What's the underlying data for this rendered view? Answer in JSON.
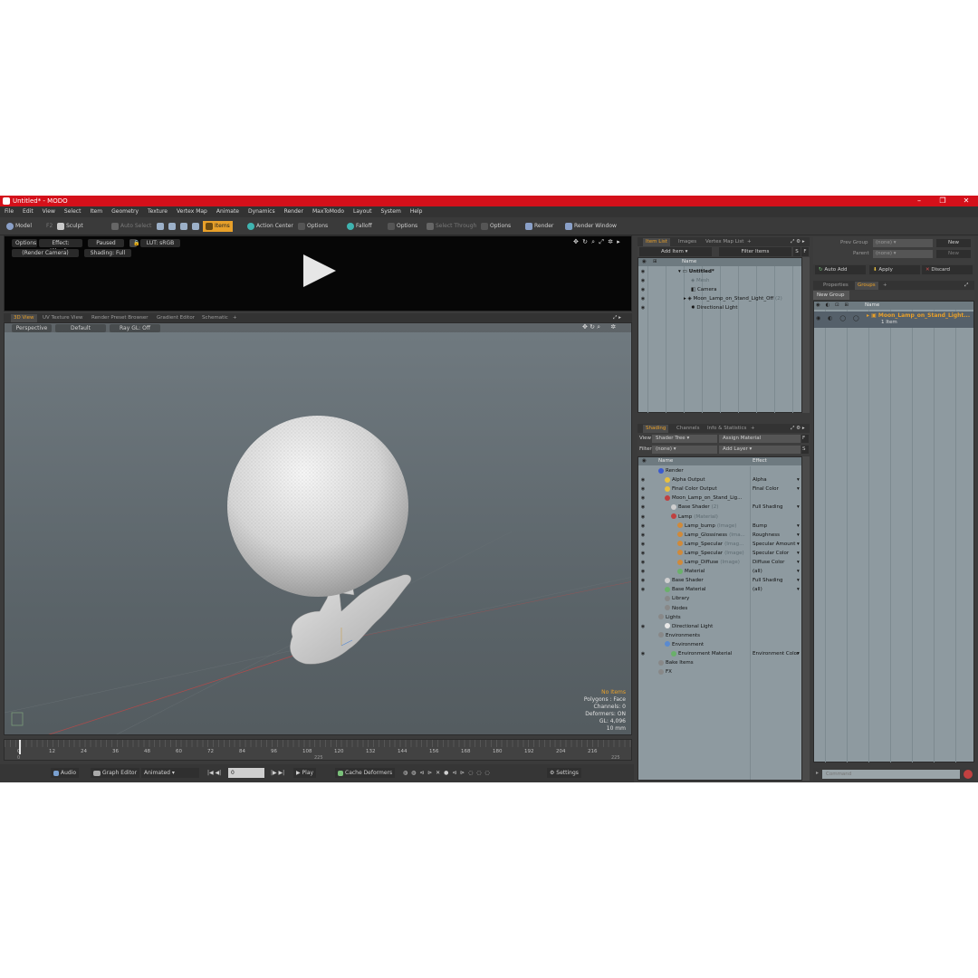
{
  "window": {
    "title": "Untitled* - MODO",
    "controls": [
      "–",
      "❐",
      "✕"
    ]
  },
  "menu": [
    "File",
    "Edit",
    "View",
    "Select",
    "Item",
    "Geometry",
    "Texture",
    "Vertex Map",
    "Animate",
    "Dynamics",
    "Render",
    "MaxToModo",
    "Layout",
    "System",
    "Help"
  ],
  "toolbar": {
    "model": "Model",
    "f2": "F2",
    "sculpt": "Sculpt",
    "auto_select": "Auto Select",
    "items": "Items",
    "action_center": "Action Center",
    "options1": "Options",
    "falloff": "Falloff",
    "options2": "Options",
    "select_through": "Select Through",
    "options3": "Options",
    "render": "Render",
    "render_window": "Render Window"
  },
  "render_preview": {
    "options": "Options",
    "effect": "Effect: (Shadi...",
    "paused": "Paused",
    "lut": "LUT: sRGB",
    "camera": "(Render Camera)",
    "shading": "Shading: Full"
  },
  "viewport_tabs": [
    "3D View",
    "UV Texture View",
    "Render Preset Browser",
    "Gradient Editor",
    "Schematic",
    "+"
  ],
  "viewport": {
    "perspective": "Perspective",
    "default": "Default",
    "raygl": "Ray GL: Off",
    "info": {
      "no_items": "No Items",
      "polygons": "Polygons : Face",
      "channels": "Channels: 0",
      "deformers": "Deformers: ON",
      "gl": "GL: 4,096",
      "scale": "10 mm"
    }
  },
  "timeline": {
    "ticks": [
      "0",
      "12",
      "24",
      "36",
      "48",
      "60",
      "72",
      "84",
      "96",
      "108",
      "120",
      "132",
      "144",
      "156",
      "168",
      "180",
      "192",
      "204",
      "216"
    ],
    "start": "0",
    "mid": "225",
    "end": "225"
  },
  "bottombar": {
    "audio": "Audio",
    "graph_editor": "Graph Editor",
    "animated": "Animated",
    "frame": "0",
    "play": "Play",
    "cache_deformers": "Cache Deformers",
    "settings": "Settings"
  },
  "item_list": {
    "tabs": [
      "Item List",
      "Images",
      "Vertex Map List",
      "+"
    ],
    "add_item": "Add Item",
    "filter_items": "Filter Items",
    "s": "S",
    "f": "F",
    "col_name": "Name",
    "items": [
      {
        "label": "Untitled*",
        "indent": 0
      },
      {
        "label": "Mesh",
        "indent": 1
      },
      {
        "label": "Camera",
        "indent": 1
      },
      {
        "label": "Moon_Lamp_on_Stand_Light_Off",
        "suffix": "(2)",
        "indent": 1
      },
      {
        "label": "Directional Light",
        "indent": 1
      }
    ]
  },
  "shading": {
    "tabs": [
      "Shading",
      "Channels",
      "Info & Statistics",
      "+"
    ],
    "view_label": "View",
    "view_value": "Shader Tree",
    "assign_material": "Assign Material",
    "filter_label": "Filter",
    "filter_value": "(none)",
    "add_layer": "Add Layer",
    "f": "F",
    "s": "S",
    "col_name": "Name",
    "col_effect": "Effect",
    "rows": [
      {
        "label": "Render",
        "effect": "",
        "indent": 0
      },
      {
        "label": "Alpha Output",
        "effect": "Alpha",
        "indent": 1
      },
      {
        "label": "Final Color Output",
        "effect": "Final Color",
        "indent": 1
      },
      {
        "label": "Moon_Lamp_on_Stand_Lig...",
        "effect": "",
        "indent": 1
      },
      {
        "label": "Base Shader",
        "suffix": "(2)",
        "effect": "Full Shading",
        "indent": 2
      },
      {
        "label": "Lamp",
        "suffix": "(Material)",
        "effect": "",
        "indent": 2
      },
      {
        "label": "Lamp_bump",
        "suffix": "(Image)",
        "effect": "Bump",
        "indent": 3
      },
      {
        "label": "Lamp_Glossiness",
        "suffix": "(Ima...",
        "effect": "Roughness",
        "indent": 3
      },
      {
        "label": "Lamp_Specular",
        "suffix": "(Imag...",
        "effect": "Specular Amount",
        "indent": 3
      },
      {
        "label": "Lamp_Specular",
        "suffix": "(Image)",
        "effect": "Specular Color",
        "indent": 3
      },
      {
        "label": "Lamp_Diffuse",
        "suffix": "(Image)",
        "effect": "Diffuse Color",
        "indent": 3
      },
      {
        "label": "Material",
        "effect": "(all)",
        "indent": 3
      },
      {
        "label": "Base Shader",
        "effect": "Full Shading",
        "indent": 1
      },
      {
        "label": "Base Material",
        "effect": "(all)",
        "indent": 1
      },
      {
        "label": "Library",
        "effect": "",
        "indent": 1
      },
      {
        "label": "Nodes",
        "effect": "",
        "indent": 1
      },
      {
        "label": "Lights",
        "effect": "",
        "indent": 0
      },
      {
        "label": "Directional Light",
        "effect": "",
        "indent": 1
      },
      {
        "label": "Environments",
        "effect": "",
        "indent": 0
      },
      {
        "label": "Environment",
        "effect": "",
        "indent": 1
      },
      {
        "label": "Environment Material",
        "effect": "Environment Color",
        "indent": 2
      },
      {
        "label": "Bake Items",
        "effect": "",
        "indent": 0
      },
      {
        "label": "FX",
        "effect": "",
        "indent": 0
      }
    ]
  },
  "groups_panel": {
    "prev_group_label": "Prev Group",
    "prev_group_value": "(none)",
    "new": "New",
    "parent_label": "Parent",
    "parent_value": "(none)",
    "new2": "New",
    "auto_add": "Auto Add",
    "apply": "Apply",
    "discard": "Discard",
    "tabs": [
      "Properties",
      "Groups",
      "+"
    ],
    "new_group": "New Group",
    "col_name": "Name",
    "group_name": "Moon_Lamp_on_Stand_Light...",
    "group_count": "1 Item",
    "command_placeholder": "Command"
  },
  "colors": {
    "titlebar": "#d4101a",
    "accent": "#e8a02a",
    "panel": "#8e9aa0"
  }
}
